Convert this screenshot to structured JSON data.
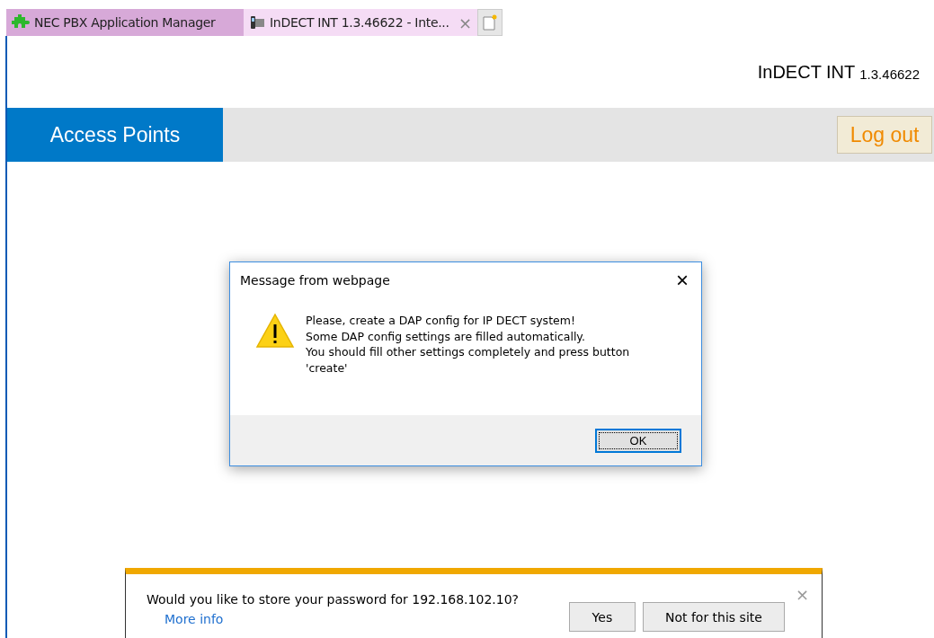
{
  "browser_tabs": [
    {
      "title": "NEC PBX Application Manager",
      "kind": "puzzle",
      "selected": false,
      "closable": false
    },
    {
      "title": "InDECT INT 1.3.46622 - Inte...",
      "kind": "device",
      "selected": true,
      "closable": true
    }
  ],
  "close_tab": "×",
  "header": {
    "product": "InDECT INT",
    "version": "1.3.46622"
  },
  "nav": {
    "section": "Access Points",
    "logout": "Log out"
  },
  "dialog": {
    "title": "Message from webpage",
    "close": "×",
    "lines": [
      "Please, create a DAP config for IP DECT system!",
      "Some DAP config settings are filled automatically.",
      "You should fill other settings completely and press button",
      "'create'"
    ],
    "ok": "OK"
  },
  "password_bar": {
    "message": "Would you like to store your password for 192.168.102.10?",
    "link": "More info",
    "yes": "Yes",
    "no": "Not for this site",
    "close": "×"
  }
}
